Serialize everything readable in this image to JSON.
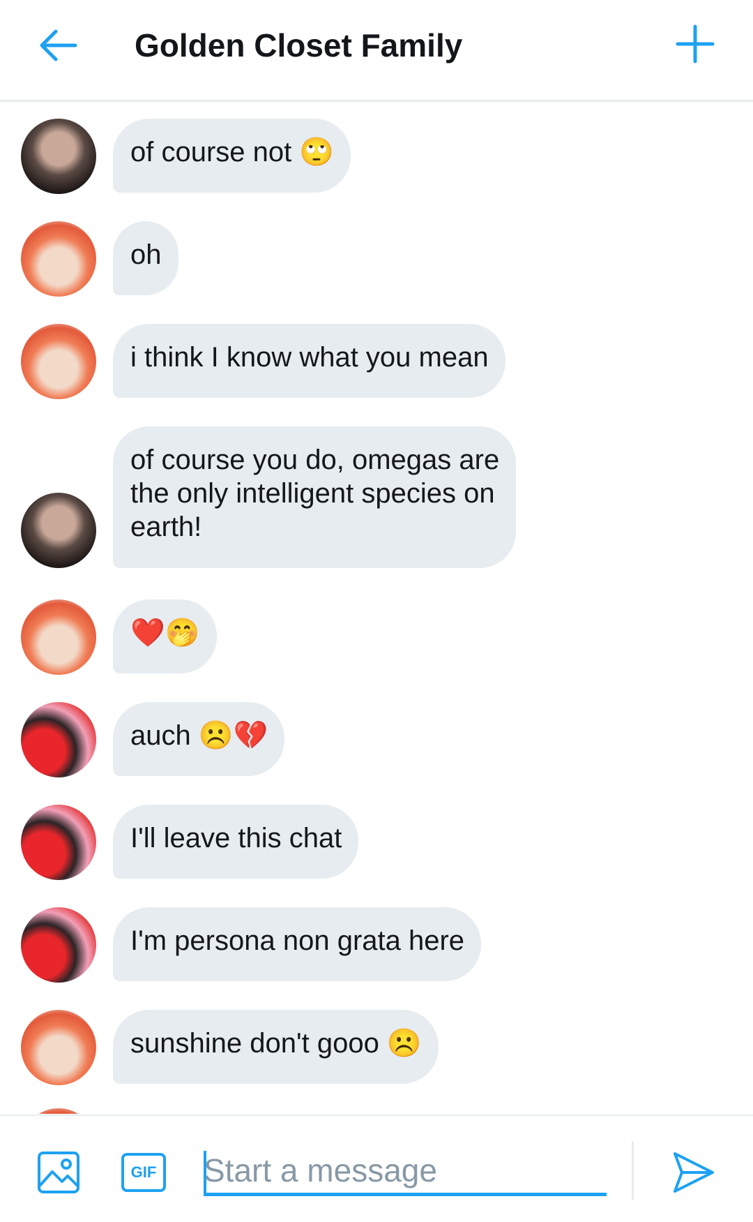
{
  "header": {
    "title": "Golden Closet Family",
    "back_icon": "arrow-left-icon",
    "add_icon": "plus-icon"
  },
  "messages": [
    {
      "sender_avatar": "dark",
      "text": "of course not 🙄"
    },
    {
      "sender_avatar": "orange",
      "text": "oh"
    },
    {
      "sender_avatar": "orange",
      "text": "i think I know what you mean"
    },
    {
      "sender_avatar": "dark",
      "text": "of course you do, omegas are\nthe only intelligent species on\nearth!"
    },
    {
      "sender_avatar": "orange",
      "text": "❤️🤭"
    },
    {
      "sender_avatar": "red",
      "text": "auch ☹️💔"
    },
    {
      "sender_avatar": "red",
      "text": "I'll leave this chat"
    },
    {
      "sender_avatar": "red",
      "text": "I'm persona non grata here"
    },
    {
      "sender_avatar": "orange",
      "text": "sunshine don't gooo ☹️"
    }
  ],
  "composer": {
    "placeholder": "Start a message",
    "gif_label": "GIF",
    "media_icon": "image-icon",
    "send_icon": "send-icon"
  },
  "colors": {
    "accent": "#1da1f2",
    "bubble": "#e6ecf0",
    "text": "#14171a",
    "placeholder": "#8899a6"
  }
}
